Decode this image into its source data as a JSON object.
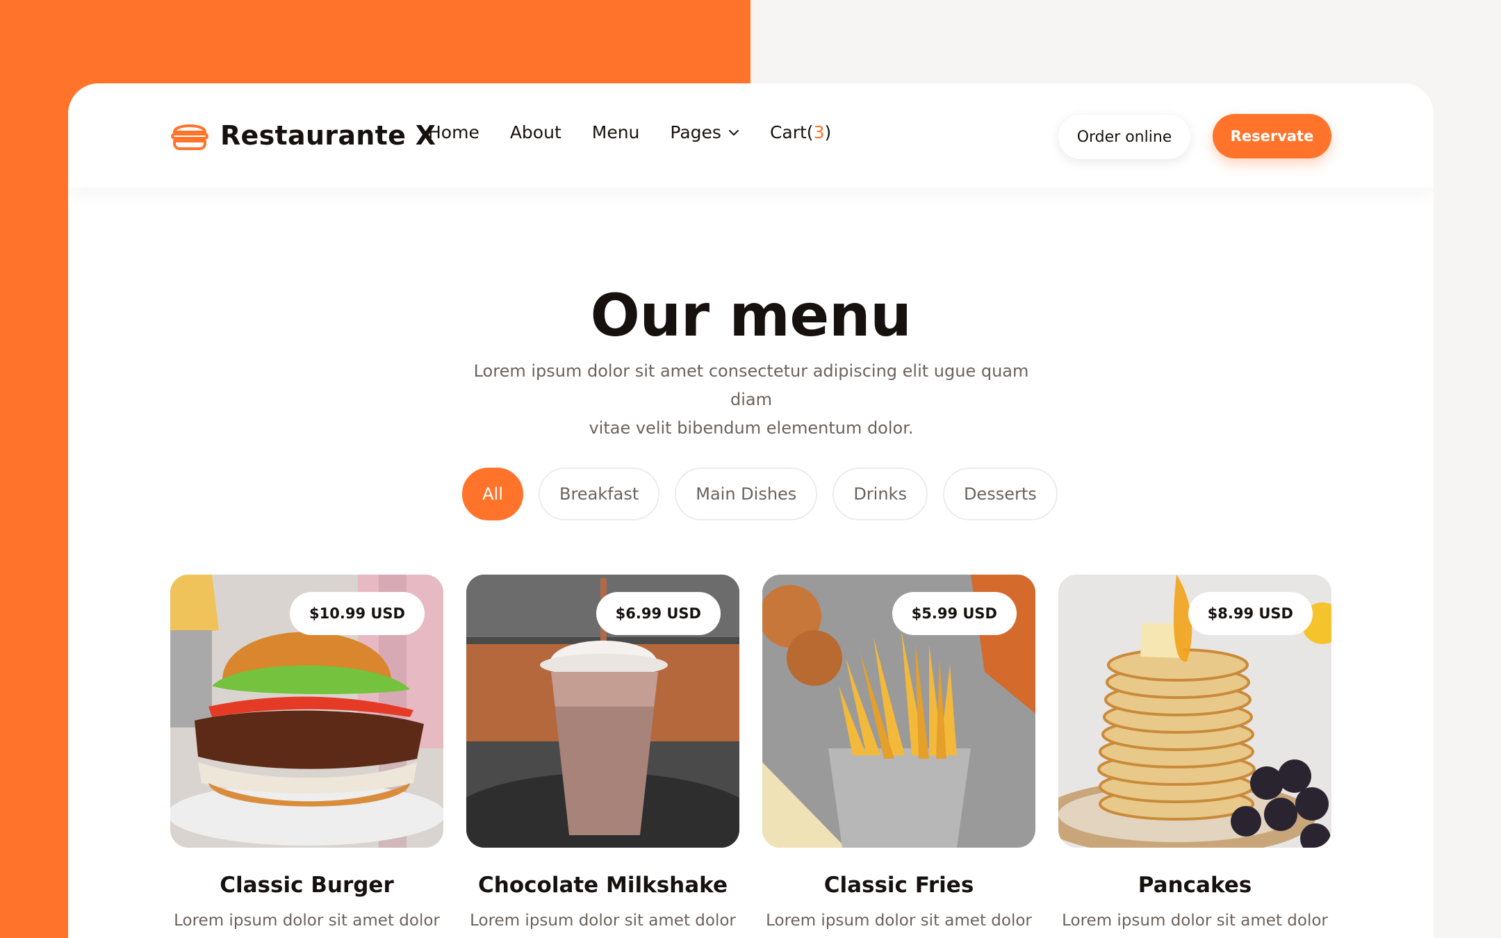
{
  "brand": {
    "name": "Restaurante X",
    "logo_icon": "burger-icon",
    "accent_color": "#ff742a"
  },
  "nav": {
    "home": "Home",
    "about": "About",
    "menu": "Menu",
    "pages": "Pages",
    "cart_label": "Cart(",
    "cart_count": "3",
    "cart_close": ")"
  },
  "header_actions": {
    "order_online": "Order online",
    "reservate": "Reservate"
  },
  "hero": {
    "title": "Our menu",
    "subtitle_line1": "Lorem ipsum dolor sit amet consectetur adipiscing elit ugue quam diam",
    "subtitle_line2": "vitae velit bibendum elementum dolor."
  },
  "filters": [
    {
      "label": "All",
      "active": true
    },
    {
      "label": "Breakfast",
      "active": false
    },
    {
      "label": "Main Dishes",
      "active": false
    },
    {
      "label": "Drinks",
      "active": false
    },
    {
      "label": "Desserts",
      "active": false
    }
  ],
  "menu_items": [
    {
      "title": "Classic Burger",
      "price": "$10.99 USD",
      "description": "Lorem ipsum dolor sit amet dolor"
    },
    {
      "title": "Chocolate Milkshake",
      "price": "$6.99 USD",
      "description": "Lorem ipsum dolor sit amet dolor"
    },
    {
      "title": "Classic Fries",
      "price": "$5.99 USD",
      "description": "Lorem ipsum dolor sit amet dolor"
    },
    {
      "title": "Pancakes",
      "price": "$8.99 USD",
      "description": "Lorem ipsum dolor sit amet dolor"
    }
  ]
}
